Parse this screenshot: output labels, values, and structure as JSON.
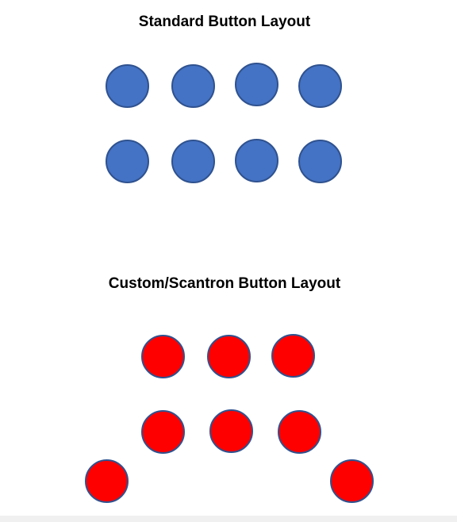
{
  "standard": {
    "title": "Standard Button Layout",
    "button_color": "#4472c4",
    "button_border_color": "#2f528f",
    "rows": 2,
    "buttons_per_row": 4
  },
  "custom": {
    "title": "Custom/Scantron Button Layout",
    "button_color": "#ff0000",
    "button_border_color": "#2f528f",
    "button_count": 8
  }
}
